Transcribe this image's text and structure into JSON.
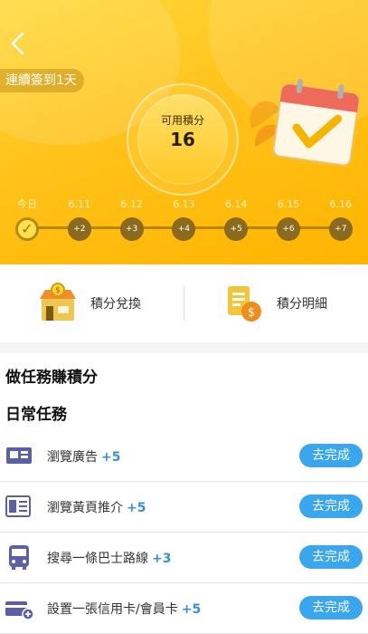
{
  "header": {
    "streak": "連續簽到1天",
    "points_label": "可用積分",
    "points_value": "16"
  },
  "checkin": [
    {
      "date": "今日",
      "reward": "✓",
      "done": true
    },
    {
      "date": "6.11",
      "reward": "+2",
      "done": false
    },
    {
      "date": "6.12",
      "reward": "+3",
      "done": false
    },
    {
      "date": "6.13",
      "reward": "+4",
      "done": false
    },
    {
      "date": "6.14",
      "reward": "+5",
      "done": false
    },
    {
      "date": "6.15",
      "reward": "+6",
      "done": false
    },
    {
      "date": "6.16",
      "reward": "+7",
      "done": false
    }
  ],
  "quick_actions": {
    "redeem_label": "積分兌換",
    "details_label": "積分明細"
  },
  "sections": {
    "tasks_title": "做任務賺積分",
    "daily_title": "日常任務"
  },
  "tasks": [
    {
      "label": "瀏覽廣告",
      "bonus": "+5",
      "button": "去完成",
      "icon": "ad-icon"
    },
    {
      "label": "瀏覽黃頁推介",
      "bonus": "+5",
      "button": "去完成",
      "icon": "yellow-pages-icon"
    },
    {
      "label": "搜尋一條巴士路線",
      "bonus": "+3",
      "button": "去完成",
      "icon": "bus-icon"
    },
    {
      "label": "設置一張信用卡/會員卡",
      "bonus": "+5",
      "button": "去完成",
      "icon": "card-add-icon"
    }
  ],
  "colors": {
    "hero": "#ffc21a",
    "button": "#3aa6ee",
    "bonus": "#3a8fd6",
    "icon": "#5a5fa8"
  }
}
